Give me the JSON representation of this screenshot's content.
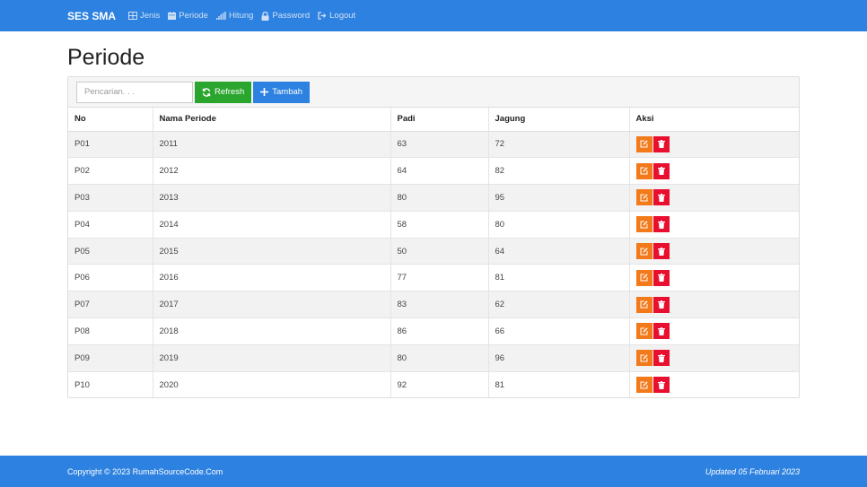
{
  "navbar": {
    "brand": "SES SMA",
    "items": [
      {
        "label": "Jenis",
        "icon": "table-icon"
      },
      {
        "label": "Periode",
        "icon": "calendar-icon"
      },
      {
        "label": "Hitung",
        "icon": "signal-icon"
      },
      {
        "label": "Password",
        "icon": "lock-icon"
      },
      {
        "label": "Logout",
        "icon": "logout-icon"
      }
    ]
  },
  "page": {
    "title": "Periode"
  },
  "toolbar": {
    "search_placeholder": "Pencarian. . .",
    "refresh_label": "Refresh",
    "add_label": "Tambah"
  },
  "table": {
    "headers": [
      "No",
      "Nama Periode",
      "Padi",
      "Jagung",
      "Aksi"
    ],
    "rows": [
      {
        "no": "P01",
        "nama": "2011",
        "padi": "63",
        "jagung": "72"
      },
      {
        "no": "P02",
        "nama": "2012",
        "padi": "64",
        "jagung": "82"
      },
      {
        "no": "P03",
        "nama": "2013",
        "padi": "80",
        "jagung": "95"
      },
      {
        "no": "P04",
        "nama": "2014",
        "padi": "58",
        "jagung": "80"
      },
      {
        "no": "P05",
        "nama": "2015",
        "padi": "50",
        "jagung": "64"
      },
      {
        "no": "P06",
        "nama": "2016",
        "padi": "77",
        "jagung": "81"
      },
      {
        "no": "P07",
        "nama": "2017",
        "padi": "83",
        "jagung": "62"
      },
      {
        "no": "P08",
        "nama": "2018",
        "padi": "86",
        "jagung": "66"
      },
      {
        "no": "P09",
        "nama": "2019",
        "padi": "80",
        "jagung": "96"
      },
      {
        "no": "P10",
        "nama": "2020",
        "padi": "92",
        "jagung": "81"
      }
    ]
  },
  "footer": {
    "copyright": "Copyright © 2023 RumahSourceCode.Com",
    "updated": "Updated 05 Februari 2023"
  },
  "colors": {
    "primary": "#2d81e0",
    "success": "#2aa62e",
    "edit": "#f27a1a",
    "delete": "#e8102e"
  }
}
